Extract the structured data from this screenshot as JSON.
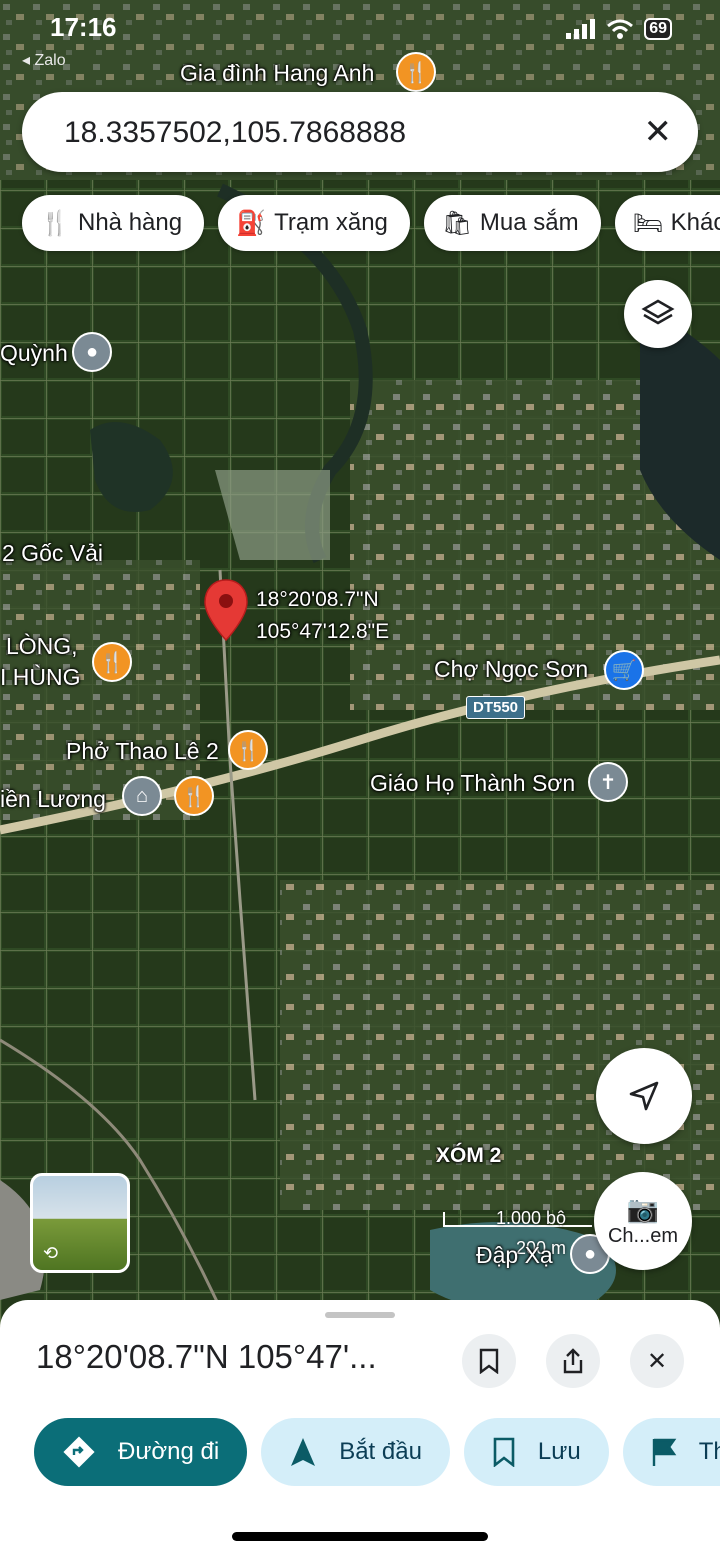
{
  "status_bar": {
    "time": "17:16",
    "back_app": "◂ Zalo",
    "battery": "69"
  },
  "search": {
    "value": "18.3357502,105.7868888"
  },
  "chips": [
    {
      "icon": "restaurant-icon",
      "glyph": "🍴",
      "label": "Nhà hàng"
    },
    {
      "icon": "gas-station-icon",
      "glyph": "⛽",
      "label": "Trạm xăng"
    },
    {
      "icon": "shopping-bag-icon",
      "glyph": "🛍",
      "label": "Mua sắm"
    },
    {
      "icon": "hotel-icon",
      "glyph": "🛏",
      "label": "Khác"
    }
  ],
  "map": {
    "pin_coords": {
      "lat": "18°20'08.7\"N",
      "lng": "105°47'12.8\"E"
    },
    "labels": {
      "gia_dinh": "Gia đình Hang Anh",
      "quynh": "Quỳnh",
      "goc_vai": "2 Gốc Vải",
      "long": "LÒNG,",
      "hung": "I HÙNG",
      "cho_ngoc_son": "Chợ Ngọc Sơn",
      "dt550": "DT550",
      "pho_thao": "Phở Thao Lê 2",
      "tien_luong": "iền Lương",
      "giao_ho": "Giáo Họ Thành Sơn",
      "xom2": "XÓM 2",
      "dap_xa": "Đập Xạ"
    },
    "scale": {
      "imperial": "1.000 bộ",
      "metric": "200 m"
    },
    "camera_label": "Ch...em"
  },
  "sheet": {
    "title": "18°20'08.7\"N 105°47'...",
    "actions": [
      {
        "label": "Đường đi",
        "icon": "directions-icon"
      },
      {
        "label": "Bắt đầu",
        "icon": "navigate-icon"
      },
      {
        "label": "Lưu",
        "icon": "bookmark-icon"
      },
      {
        "label": "Th",
        "icon": "flag-icon"
      }
    ]
  },
  "colors": {
    "primary_button": "#0b6e78",
    "secondary_button": "#d4eef9",
    "poi_food": "#f29423",
    "poi_shop": "#1a73e8",
    "poi_generic": "#7b8a94",
    "pin": "#e53935"
  }
}
